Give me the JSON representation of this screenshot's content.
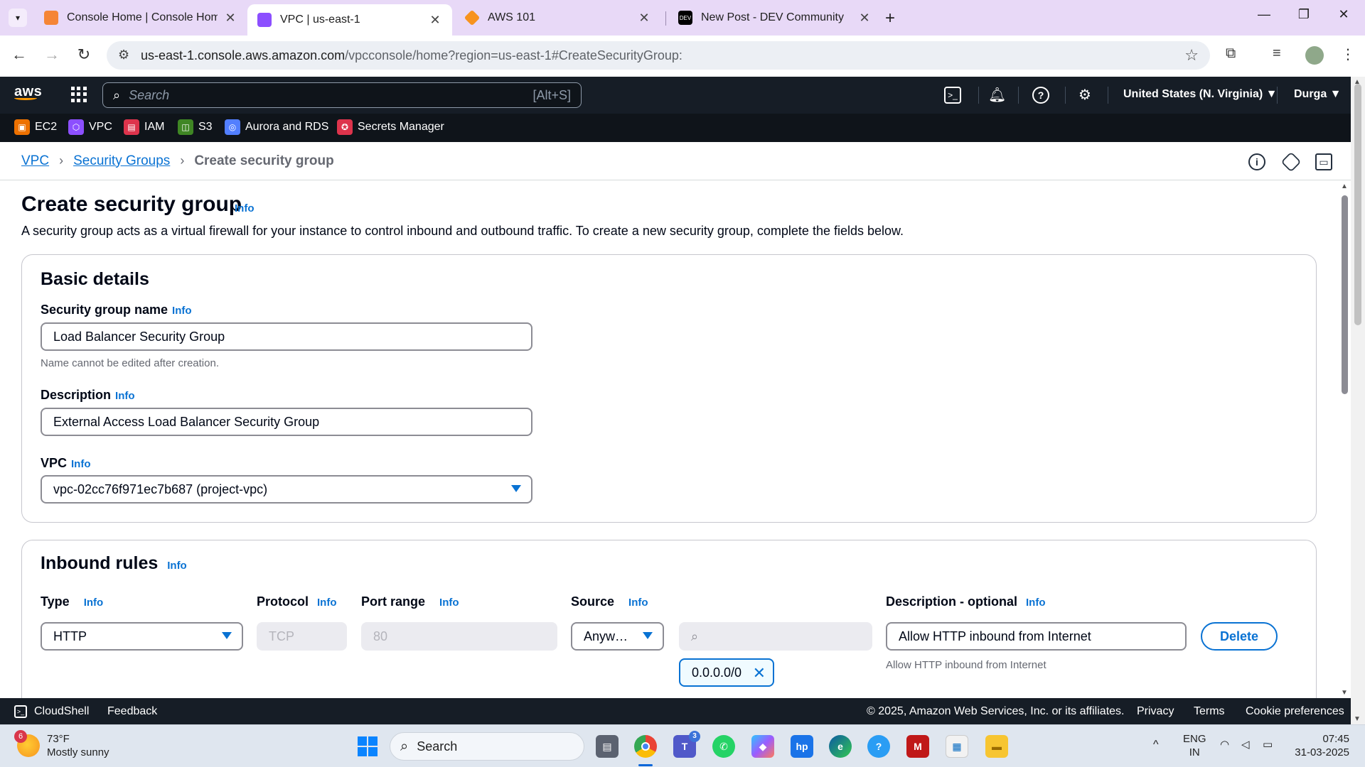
{
  "browser": {
    "tabs": [
      {
        "title": "Console Home | Console Home",
        "favicon_color": "#f58536"
      },
      {
        "title": "VPC | us-east-1",
        "favicon_color": "#8c4fff"
      },
      {
        "title": "AWS 101",
        "favicon_color": "#f7931e"
      },
      {
        "title": "New Post - DEV Community",
        "favicon_color": "#000000"
      }
    ],
    "active_tab": 1,
    "url_host": "us-east-1.console.aws.amazon.com",
    "url_path": "/vpcconsole/home?region=us-east-1#CreateSecurityGroup:"
  },
  "aws_nav": {
    "logo": "aws",
    "search_placeholder": "Search",
    "search_shortcut": "[Alt+S]",
    "region": "United States (N. Virginia) ▼",
    "user": "Durga ▼"
  },
  "services": [
    {
      "label": "EC2",
      "color": "#ed7100"
    },
    {
      "label": "VPC",
      "color": "#8c4fff"
    },
    {
      "label": "IAM",
      "color": "#dd344c"
    },
    {
      "label": "S3",
      "color": "#3f8624"
    },
    {
      "label": "Aurora and RDS",
      "color": "#527fff"
    },
    {
      "label": "Secrets Manager",
      "color": "#dd344c"
    }
  ],
  "breadcrumb": {
    "items": [
      "VPC",
      "Security Groups"
    ],
    "current": "Create security group"
  },
  "page": {
    "title": "Create security group",
    "info": "Info",
    "subtitle": "A security group acts as a virtual firewall for your instance to control inbound and outbound traffic. To create a new security group, complete the fields below."
  },
  "basic_details": {
    "heading": "Basic details",
    "name_label": "Security group name",
    "name_value": "Load Balancer Security Group",
    "name_hint": "Name cannot be edited after creation.",
    "desc_label": "Description",
    "desc_value": "External Access Load Balancer Security Group",
    "vpc_label": "VPC",
    "vpc_value": "vpc-02cc76f971ec7b687 (project-vpc)"
  },
  "inbound": {
    "heading": "Inbound rules",
    "col_type": "Type",
    "col_protocol": "Protocol",
    "col_port": "Port range",
    "col_source": "Source",
    "col_desc": "Description - optional",
    "type_value": "HTTP",
    "protocol_value": "TCP",
    "port_value": "80",
    "source_value": "Anyw…",
    "cidr_token": "0.0.0.0/0",
    "desc_value": "Allow HTTP inbound from Internet",
    "desc_hint": "Allow HTTP inbound from Internet",
    "delete_label": "Delete"
  },
  "aws_footer": {
    "cloudshell": "CloudShell",
    "feedback": "Feedback",
    "copyright": "© 2025, Amazon Web Services, Inc. or its affiliates.",
    "privacy": "Privacy",
    "terms": "Terms",
    "cookies": "Cookie preferences"
  },
  "taskbar": {
    "weather_temp": "73°F",
    "weather_desc": "Mostly sunny",
    "weather_badge": "6",
    "search": "Search",
    "lang1": "ENG",
    "lang2": "IN",
    "time": "07:45",
    "date": "31-03-2025",
    "teams_badge": "3"
  }
}
